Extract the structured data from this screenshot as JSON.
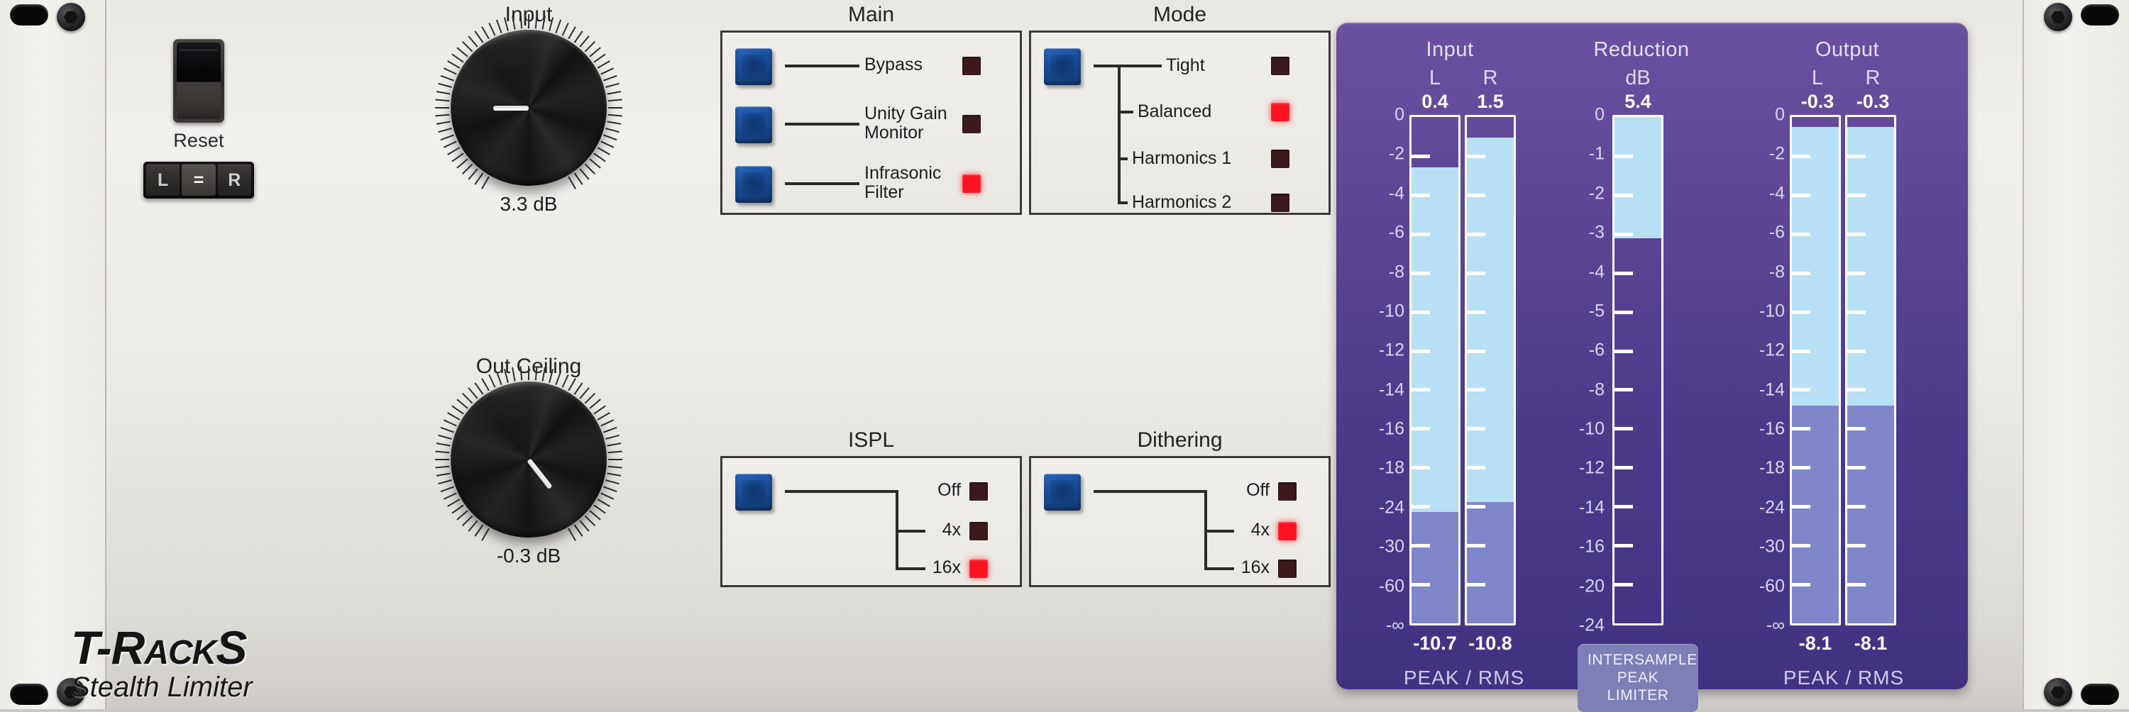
{
  "plugin": {
    "brand": "T-Rack",
    "brand_tail": "S",
    "brand_prefix": "T-R",
    "brand_caps": "ACK",
    "name": "Stealth Limiter"
  },
  "reset": {
    "label": "Reset",
    "switch_state": "up",
    "link_buttons": [
      {
        "label": "L",
        "active": false
      },
      {
        "label": "=",
        "active": true
      },
      {
        "label": "R",
        "active": false
      }
    ]
  },
  "knobs": [
    {
      "title": "Input",
      "value": "3.3 dB",
      "angle": 180
    },
    {
      "title": "Out Ceiling",
      "value": "-0.3 dB",
      "angle": 52
    }
  ],
  "panels": {
    "main": {
      "title": "Main",
      "options": [
        {
          "label": "Bypass",
          "led": "off"
        },
        {
          "label": "Unity Gain\nMonitor",
          "led": "off"
        },
        {
          "label": "Infrasonic\nFilter",
          "led": "on"
        }
      ]
    },
    "mode": {
      "title": "Mode",
      "options": [
        {
          "label": "Tight",
          "led": "off"
        },
        {
          "label": "Balanced",
          "led": "on"
        },
        {
          "label": "Harmonics 1",
          "led": "off"
        },
        {
          "label": "Harmonics 2",
          "led": "off"
        }
      ]
    },
    "ispl": {
      "title": "ISPL",
      "options": [
        {
          "label": "Off",
          "led": "off"
        },
        {
          "label": "4x",
          "led": "off"
        },
        {
          "label": "16x",
          "led": "on"
        }
      ]
    },
    "dithering": {
      "title": "Dithering",
      "options": [
        {
          "label": "Off",
          "led": "off"
        },
        {
          "label": "4x",
          "led": "on"
        },
        {
          "label": "16x",
          "led": "off"
        }
      ]
    }
  },
  "meters": {
    "input": {
      "title": "Input",
      "scale": [
        "0",
        "-2",
        "-4",
        "-6",
        "-8",
        "-10",
        "-12",
        "-14",
        "-16",
        "-18",
        "-24",
        "-30",
        "-60",
        "-∞"
      ],
      "footer": "PEAK / RMS",
      "channels": [
        {
          "label": "L",
          "peak": "0.4",
          "rms": "-10.7"
        },
        {
          "label": "R",
          "peak": "1.5",
          "rms": "-10.8"
        }
      ]
    },
    "reduction": {
      "title": "Reduction",
      "unit": "dB",
      "value": "5.4",
      "scale": [
        "0",
        "-1",
        "-2",
        "-3",
        "-4",
        "-5",
        "-6",
        "-8",
        "-10",
        "-12",
        "-14",
        "-16",
        "-20",
        "-24"
      ],
      "badge": "INTERSAMPLE\nPEAK\nLIMITER"
    },
    "output": {
      "title": "Output",
      "scale": [
        "0",
        "-2",
        "-4",
        "-6",
        "-8",
        "-10",
        "-12",
        "-14",
        "-16",
        "-18",
        "-24",
        "-30",
        "-60",
        "-∞"
      ],
      "footer": "PEAK / RMS",
      "channels": [
        {
          "label": "L",
          "peak": "-0.3",
          "rms": "-8.1"
        },
        {
          "label": "R",
          "peak": "-0.3",
          "rms": "-8.1"
        }
      ]
    }
  },
  "chart_data": {
    "type": "bar",
    "title": "Stealth Limiter metering",
    "ylabel": "dB",
    "series": [
      {
        "name": "Input L",
        "peak_db": 0.4,
        "rms_db": -10.7,
        "peak_pct": 90,
        "rms_pct": 22
      },
      {
        "name": "Input R",
        "peak_db": 1.5,
        "rms_db": -10.8,
        "peak_pct": 96,
        "rms_pct": 24
      },
      {
        "name": "Reduction",
        "value_db": 5.4,
        "fill_pct": 24
      },
      {
        "name": "Output L",
        "peak_db": -0.3,
        "rms_db": -8.1,
        "peak_pct": 98,
        "rms_pct": 43
      },
      {
        "name": "Output R",
        "peak_db": -0.3,
        "rms_db": -8.1,
        "peak_pct": 98,
        "rms_pct": 43
      }
    ]
  },
  "colors": {
    "panel": "#eceae5",
    "meter_purple": "#5c4595",
    "led_on": "#fb1420",
    "led_off": "#3a1a1c",
    "button_blue": "#1b4f9c",
    "peak_fill": "#b8e0f4",
    "rms_fill": "#7f86ca"
  }
}
